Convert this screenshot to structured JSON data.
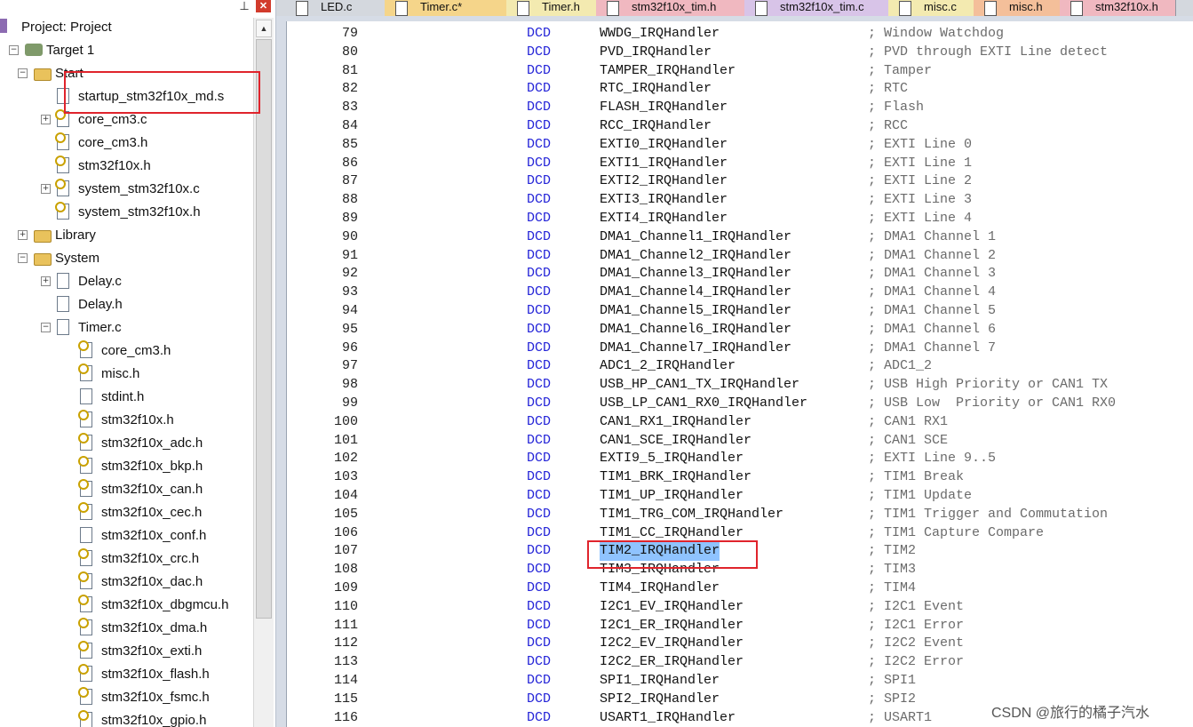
{
  "tree": {
    "rows": [
      {
        "label": "Project: Project",
        "depth": 0,
        "icon": "project-icon",
        "expander": "none"
      },
      {
        "label": "Target 1",
        "depth": 1,
        "icon": "target-icon",
        "expander": "minus"
      },
      {
        "label": "Start",
        "depth": 2,
        "icon": "folder-icon",
        "expander": "minus"
      },
      {
        "label": "startup_stm32f10x_md.s",
        "depth": 3,
        "icon": "file-icon",
        "expander": "none"
      },
      {
        "label": "core_cm3.c",
        "depth": 3,
        "icon": "fileh-icon",
        "expander": "plus"
      },
      {
        "label": "core_cm3.h",
        "depth": 3,
        "icon": "fileh-icon",
        "expander": "none"
      },
      {
        "label": "stm32f10x.h",
        "depth": 3,
        "icon": "fileh-icon",
        "expander": "none"
      },
      {
        "label": "system_stm32f10x.c",
        "depth": 3,
        "icon": "fileh-icon",
        "expander": "plus"
      },
      {
        "label": "system_stm32f10x.h",
        "depth": 3,
        "icon": "fileh-icon",
        "expander": "none"
      },
      {
        "label": "Library",
        "depth": 2,
        "icon": "folder-icon",
        "expander": "plus"
      },
      {
        "label": "System",
        "depth": 2,
        "icon": "folder-icon",
        "expander": "minus"
      },
      {
        "label": "Delay.c",
        "depth": 3,
        "icon": "file-icon",
        "expander": "plus"
      },
      {
        "label": "Delay.h",
        "depth": 3,
        "icon": "file-icon",
        "expander": "none"
      },
      {
        "label": "Timer.c",
        "depth": 3,
        "icon": "file-icon",
        "expander": "minus"
      },
      {
        "label": "core_cm3.h",
        "depth": 4,
        "icon": "fileh-icon",
        "expander": "none"
      },
      {
        "label": "misc.h",
        "depth": 4,
        "icon": "fileh-icon",
        "expander": "none"
      },
      {
        "label": "stdint.h",
        "depth": 4,
        "icon": "file-icon",
        "expander": "none"
      },
      {
        "label": "stm32f10x.h",
        "depth": 4,
        "icon": "fileh-icon",
        "expander": "none"
      },
      {
        "label": "stm32f10x_adc.h",
        "depth": 4,
        "icon": "fileh-icon",
        "expander": "none"
      },
      {
        "label": "stm32f10x_bkp.h",
        "depth": 4,
        "icon": "fileh-icon",
        "expander": "none"
      },
      {
        "label": "stm32f10x_can.h",
        "depth": 4,
        "icon": "fileh-icon",
        "expander": "none"
      },
      {
        "label": "stm32f10x_cec.h",
        "depth": 4,
        "icon": "fileh-icon",
        "expander": "none"
      },
      {
        "label": "stm32f10x_conf.h",
        "depth": 4,
        "icon": "file-icon",
        "expander": "none"
      },
      {
        "label": "stm32f10x_crc.h",
        "depth": 4,
        "icon": "fileh-icon",
        "expander": "none"
      },
      {
        "label": "stm32f10x_dac.h",
        "depth": 4,
        "icon": "fileh-icon",
        "expander": "none"
      },
      {
        "label": "stm32f10x_dbgmcu.h",
        "depth": 4,
        "icon": "fileh-icon",
        "expander": "none"
      },
      {
        "label": "stm32f10x_dma.h",
        "depth": 4,
        "icon": "fileh-icon",
        "expander": "none"
      },
      {
        "label": "stm32f10x_exti.h",
        "depth": 4,
        "icon": "fileh-icon",
        "expander": "none"
      },
      {
        "label": "stm32f10x_flash.h",
        "depth": 4,
        "icon": "fileh-icon",
        "expander": "none"
      },
      {
        "label": "stm32f10x_fsmc.h",
        "depth": 4,
        "icon": "fileh-icon",
        "expander": "none"
      },
      {
        "label": "stm32f10x_gpio.h",
        "depth": 4,
        "icon": "fileh-icon",
        "expander": "none"
      }
    ]
  },
  "tabs": [
    {
      "label": "LED.c",
      "color": "#d4d8de"
    },
    {
      "label": "Timer.c*",
      "color": "#f5d58a"
    },
    {
      "label": "Timer.h",
      "color": "#f3eab0"
    },
    {
      "label": "stm32f10x_tim.h",
      "color": "#f0b8c0"
    },
    {
      "label": "stm32f10x_tim.c",
      "color": "#d8c4e8"
    },
    {
      "label": "misc.c",
      "color": "#f3eab0"
    },
    {
      "label": "misc.h",
      "color": "#f4bf9a"
    },
    {
      "label": "stm32f10x.h",
      "color": "#f0b8c0"
    }
  ],
  "colors": {
    "keyword": "#2525d8",
    "selection": "#8fc3ff",
    "highlight_box": "#e0242c"
  },
  "code": [
    {
      "ln": "79",
      "kw": "DCD",
      "sym": "WWDG_IRQHandler",
      "cmt": "; Window Watchdog"
    },
    {
      "ln": "80",
      "kw": "DCD",
      "sym": "PVD_IRQHandler",
      "cmt": "; PVD through EXTI Line detect"
    },
    {
      "ln": "81",
      "kw": "DCD",
      "sym": "TAMPER_IRQHandler",
      "cmt": "; Tamper"
    },
    {
      "ln": "82",
      "kw": "DCD",
      "sym": "RTC_IRQHandler",
      "cmt": "; RTC"
    },
    {
      "ln": "83",
      "kw": "DCD",
      "sym": "FLASH_IRQHandler",
      "cmt": "; Flash"
    },
    {
      "ln": "84",
      "kw": "DCD",
      "sym": "RCC_IRQHandler",
      "cmt": "; RCC"
    },
    {
      "ln": "85",
      "kw": "DCD",
      "sym": "EXTI0_IRQHandler",
      "cmt": "; EXTI Line 0"
    },
    {
      "ln": "86",
      "kw": "DCD",
      "sym": "EXTI1_IRQHandler",
      "cmt": "; EXTI Line 1"
    },
    {
      "ln": "87",
      "kw": "DCD",
      "sym": "EXTI2_IRQHandler",
      "cmt": "; EXTI Line 2"
    },
    {
      "ln": "88",
      "kw": "DCD",
      "sym": "EXTI3_IRQHandler",
      "cmt": "; EXTI Line 3"
    },
    {
      "ln": "89",
      "kw": "DCD",
      "sym": "EXTI4_IRQHandler",
      "cmt": "; EXTI Line 4"
    },
    {
      "ln": "90",
      "kw": "DCD",
      "sym": "DMA1_Channel1_IRQHandler",
      "cmt": "; DMA1 Channel 1"
    },
    {
      "ln": "91",
      "kw": "DCD",
      "sym": "DMA1_Channel2_IRQHandler",
      "cmt": "; DMA1 Channel 2"
    },
    {
      "ln": "92",
      "kw": "DCD",
      "sym": "DMA1_Channel3_IRQHandler",
      "cmt": "; DMA1 Channel 3"
    },
    {
      "ln": "93",
      "kw": "DCD",
      "sym": "DMA1_Channel4_IRQHandler",
      "cmt": "; DMA1 Channel 4"
    },
    {
      "ln": "94",
      "kw": "DCD",
      "sym": "DMA1_Channel5_IRQHandler",
      "cmt": "; DMA1 Channel 5"
    },
    {
      "ln": "95",
      "kw": "DCD",
      "sym": "DMA1_Channel6_IRQHandler",
      "cmt": "; DMA1 Channel 6"
    },
    {
      "ln": "96",
      "kw": "DCD",
      "sym": "DMA1_Channel7_IRQHandler",
      "cmt": "; DMA1 Channel 7"
    },
    {
      "ln": "97",
      "kw": "DCD",
      "sym": "ADC1_2_IRQHandler",
      "cmt": "; ADC1_2"
    },
    {
      "ln": "98",
      "kw": "DCD",
      "sym": "USB_HP_CAN1_TX_IRQHandler",
      "cmt": "; USB High Priority or CAN1 TX"
    },
    {
      "ln": "99",
      "kw": "DCD",
      "sym": "USB_LP_CAN1_RX0_IRQHandler",
      "cmt": "; USB Low  Priority or CAN1 RX0"
    },
    {
      "ln": "100",
      "kw": "DCD",
      "sym": "CAN1_RX1_IRQHandler",
      "cmt": "; CAN1 RX1"
    },
    {
      "ln": "101",
      "kw": "DCD",
      "sym": "CAN1_SCE_IRQHandler",
      "cmt": "; CAN1 SCE"
    },
    {
      "ln": "102",
      "kw": "DCD",
      "sym": "EXTI9_5_IRQHandler",
      "cmt": "; EXTI Line 9..5"
    },
    {
      "ln": "103",
      "kw": "DCD",
      "sym": "TIM1_BRK_IRQHandler",
      "cmt": "; TIM1 Break"
    },
    {
      "ln": "104",
      "kw": "DCD",
      "sym": "TIM1_UP_IRQHandler",
      "cmt": "; TIM1 Update"
    },
    {
      "ln": "105",
      "kw": "DCD",
      "sym": "TIM1_TRG_COM_IRQHandler",
      "cmt": "; TIM1 Trigger and Commutation"
    },
    {
      "ln": "106",
      "kw": "DCD",
      "sym": "TIM1_CC_IRQHandler",
      "cmt": "; TIM1 Capture Compare"
    },
    {
      "ln": "107",
      "kw": "DCD",
      "sym": "TIM2_IRQHandler",
      "cmt": "; TIM2",
      "selected": true
    },
    {
      "ln": "108",
      "kw": "DCD",
      "sym": "TIM3_IRQHandler",
      "cmt": "; TIM3"
    },
    {
      "ln": "109",
      "kw": "DCD",
      "sym": "TIM4_IRQHandler",
      "cmt": "; TIM4"
    },
    {
      "ln": "110",
      "kw": "DCD",
      "sym": "I2C1_EV_IRQHandler",
      "cmt": "; I2C1 Event"
    },
    {
      "ln": "111",
      "kw": "DCD",
      "sym": "I2C1_ER_IRQHandler",
      "cmt": "; I2C1 Error"
    },
    {
      "ln": "112",
      "kw": "DCD",
      "sym": "I2C2_EV_IRQHandler",
      "cmt": "; I2C2 Event"
    },
    {
      "ln": "113",
      "kw": "DCD",
      "sym": "I2C2_ER_IRQHandler",
      "cmt": "; I2C2 Error"
    },
    {
      "ln": "114",
      "kw": "DCD",
      "sym": "SPI1_IRQHandler",
      "cmt": "; SPI1"
    },
    {
      "ln": "115",
      "kw": "DCD",
      "sym": "SPI2_IRQHandler",
      "cmt": "; SPI2"
    },
    {
      "ln": "116",
      "kw": "DCD",
      "sym": "USART1_IRQHandler",
      "cmt": "; USART1"
    }
  ],
  "watermark": "CSDN @旅行的橘子汽水"
}
